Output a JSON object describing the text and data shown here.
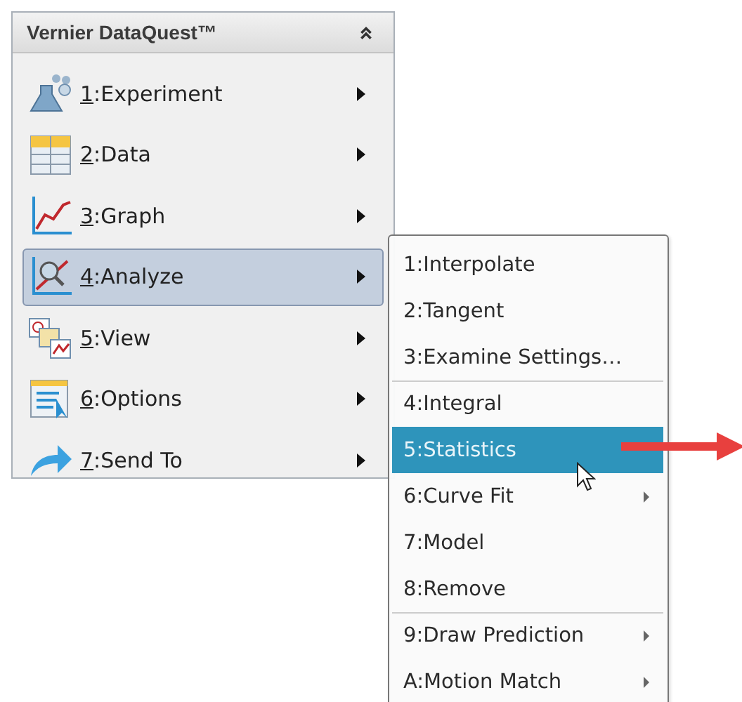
{
  "panel": {
    "title": "Vernier DataQuest™",
    "collapsed": false
  },
  "menu": [
    {
      "label": "1:Experiment",
      "selected": false,
      "has_submenu": true
    },
    {
      "label": "2:Data",
      "selected": false,
      "has_submenu": true
    },
    {
      "label": "3:Graph",
      "selected": false,
      "has_submenu": true
    },
    {
      "label": "4:Analyze",
      "selected": true,
      "has_submenu": true
    },
    {
      "label": "5:View",
      "selected": false,
      "has_submenu": true
    },
    {
      "label": "6:Options",
      "selected": false,
      "has_submenu": true
    },
    {
      "label": "7:Send To",
      "selected": false,
      "has_submenu": true
    }
  ],
  "submenu": [
    {
      "label": "1:Interpolate",
      "selected": false,
      "has_submenu": false,
      "separator_before": false
    },
    {
      "label": "2:Tangent",
      "selected": false,
      "has_submenu": false,
      "separator_before": false
    },
    {
      "label": "3:Examine Settings…",
      "selected": false,
      "has_submenu": false,
      "separator_before": false
    },
    {
      "label": "4:Integral",
      "selected": false,
      "has_submenu": false,
      "separator_before": true
    },
    {
      "label": "5:Statistics",
      "selected": true,
      "has_submenu": false,
      "separator_before": false
    },
    {
      "label": "6:Curve Fit",
      "selected": false,
      "has_submenu": true,
      "separator_before": false
    },
    {
      "label": "7:Model",
      "selected": false,
      "has_submenu": false,
      "separator_before": false
    },
    {
      "label": "8:Remove",
      "selected": false,
      "has_submenu": false,
      "separator_before": false
    },
    {
      "label": "9:Draw Prediction",
      "selected": false,
      "has_submenu": true,
      "separator_before": true
    },
    {
      "label": "A:Motion Match",
      "selected": false,
      "has_submenu": true,
      "separator_before": false
    }
  ]
}
